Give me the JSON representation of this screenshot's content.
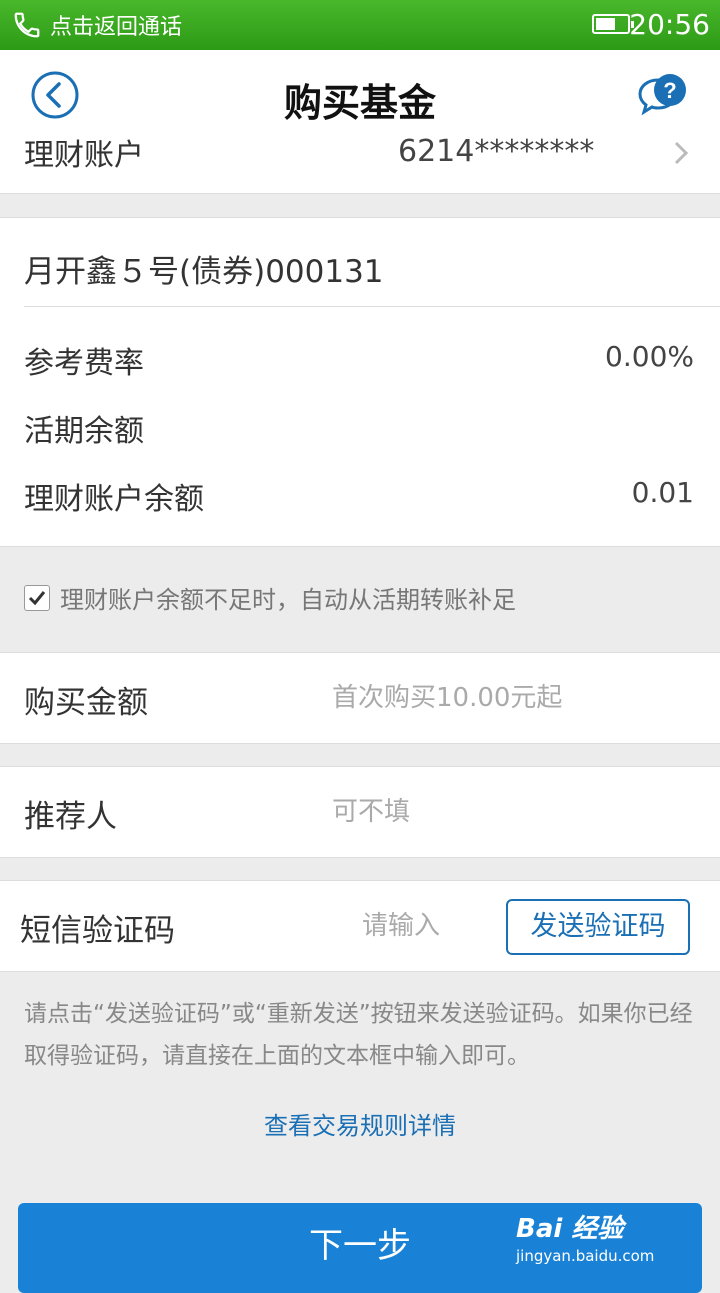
{
  "status_bar": {
    "call_text": "点击返回通话",
    "time": "20:56",
    "battery_level": 0.55
  },
  "header": {
    "title": "购买基金",
    "back_icon": "chevron-left-circle-icon",
    "help_icon": "help-chat-bubble-icon"
  },
  "account": {
    "label": "理财账户",
    "value": "6214********"
  },
  "fund": {
    "name": "月开鑫５号(债券)000131",
    "fee_label": "参考费率",
    "fee_value": "0.00%",
    "current_balance_label": "活期余额",
    "current_balance_value": "",
    "account_balance_label": "理财账户余额",
    "account_balance_value": "0.01"
  },
  "auto_transfer": {
    "checked": true,
    "text": "理财账户余额不足时，自动从活期转账补足"
  },
  "purchase_amount": {
    "label": "购买金额",
    "placeholder": "首次购买10.00元起"
  },
  "referrer": {
    "label": "推荐人",
    "placeholder": "可不填"
  },
  "sms_code": {
    "label": "短信验证码",
    "placeholder": "请输入",
    "button": "发送验证码"
  },
  "hint": "请点击“发送验证码”或“重新发送”按钮来发送验证码。如果你已经取得验证码，请直接在上面的文本框中输入即可。",
  "rules_link": "查看交易规则详情",
  "next_button": "下一步",
  "watermark": {
    "top": "Bai 经验",
    "bottom": "jingyan.baidu.com"
  },
  "colors": {
    "status_green": "#2d9a16",
    "accent_blue": "#1a6fb5",
    "button_blue": "#1a82d6"
  }
}
